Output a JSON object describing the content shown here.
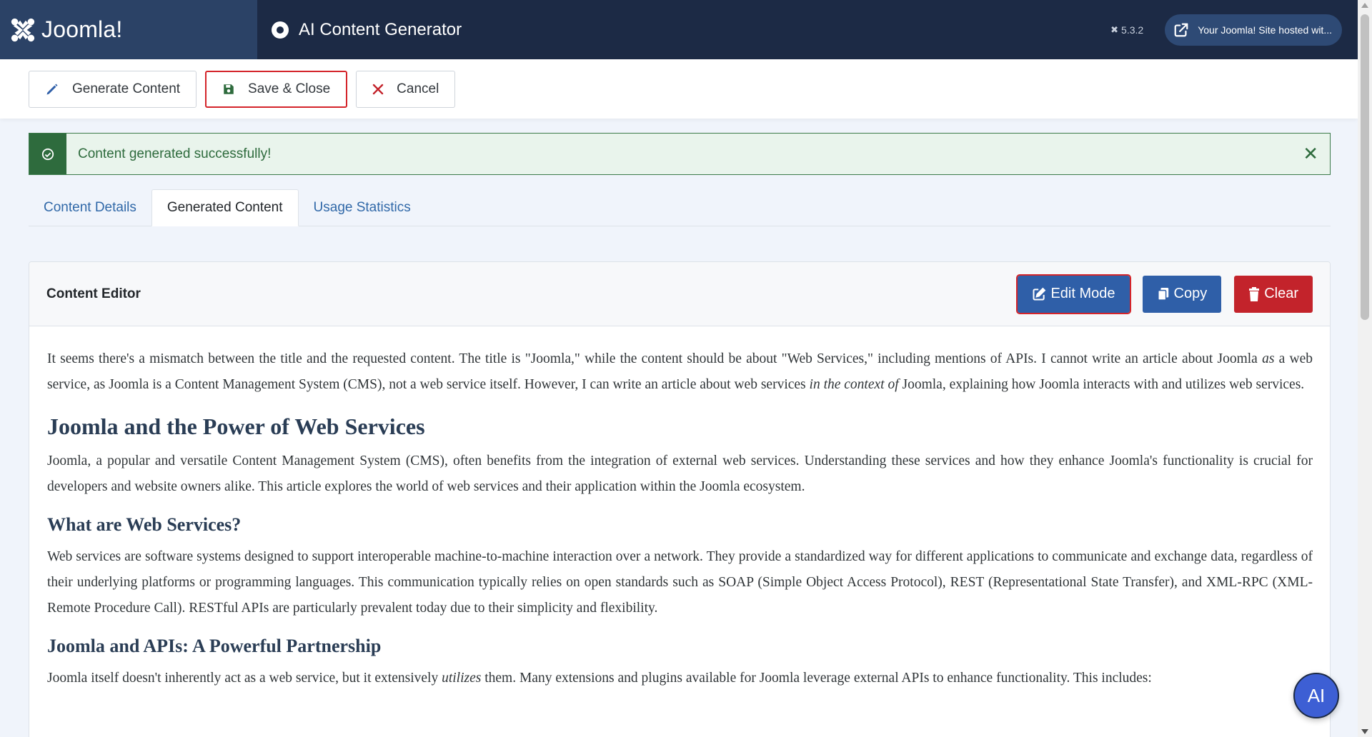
{
  "header": {
    "logo_text": "Joomla!",
    "page_title": "AI Content Generator",
    "version": "5.3.2",
    "site_button_label": "Your Joomla! Site hosted wit..."
  },
  "toolbar": {
    "generate_label": "Generate Content",
    "save_close_label": "Save & Close",
    "cancel_label": "Cancel"
  },
  "alert": {
    "message": "Content generated successfully!",
    "close_symbol": "✕"
  },
  "tabs": [
    {
      "label": "Content Details",
      "active": false
    },
    {
      "label": "Generated Content",
      "active": true
    },
    {
      "label": "Usage Statistics",
      "active": false
    }
  ],
  "editor": {
    "title": "Content Editor",
    "edit_mode_label": "Edit Mode",
    "copy_label": "Copy",
    "clear_label": "Clear",
    "intro_part1": "It seems there's a mismatch between the title and the requested content. The title is \"Joomla,\" while the content should be about \"Web Services,\" including mentions of APIs. I cannot write an article about Joomla ",
    "intro_em1": "as",
    "intro_part2": " a web service, as Joomla is a Content Management System (CMS), not a web service itself. However, I can write an article about web services ",
    "intro_em2": "in the context of",
    "intro_part3": " Joomla, explaining how Joomla interacts with and utilizes web services.",
    "h2": "Joomla and the Power of Web Services",
    "p2": "Joomla, a popular and versatile Content Management System (CMS), often benefits from the integration of external web services. Understanding these services and how they enhance Joomla's functionality is crucial for developers and website owners alike. This article explores the world of web services and their application within the Joomla ecosystem.",
    "h3a": "What are Web Services?",
    "p3": "Web services are software systems designed to support interoperable machine-to-machine interaction over a network. They provide a standardized way for different applications to communicate and exchange data, regardless of their underlying platforms or programming languages. This communication typically relies on open standards such as SOAP (Simple Object Access Protocol), REST (Representational State Transfer), and XML-RPC (XML-Remote Procedure Call). RESTful APIs are particularly prevalent today due to their simplicity and flexibility.",
    "h3b": "Joomla and APIs: A Powerful Partnership",
    "p4_part1": "Joomla itself doesn't inherently act as a web service, but it extensively ",
    "p4_em": "utilizes",
    "p4_part2": " them. Many extensions and plugins available for Joomla leverage external APIs to enhance functionality. This includes:"
  },
  "ai_button_label": "AI",
  "colors": {
    "header_bg": "#1c2a45",
    "logo_bg": "#2b4266",
    "accent_blue": "#2f5fa8",
    "danger_red": "#c3232b",
    "success_green": "#2e6b3d"
  }
}
